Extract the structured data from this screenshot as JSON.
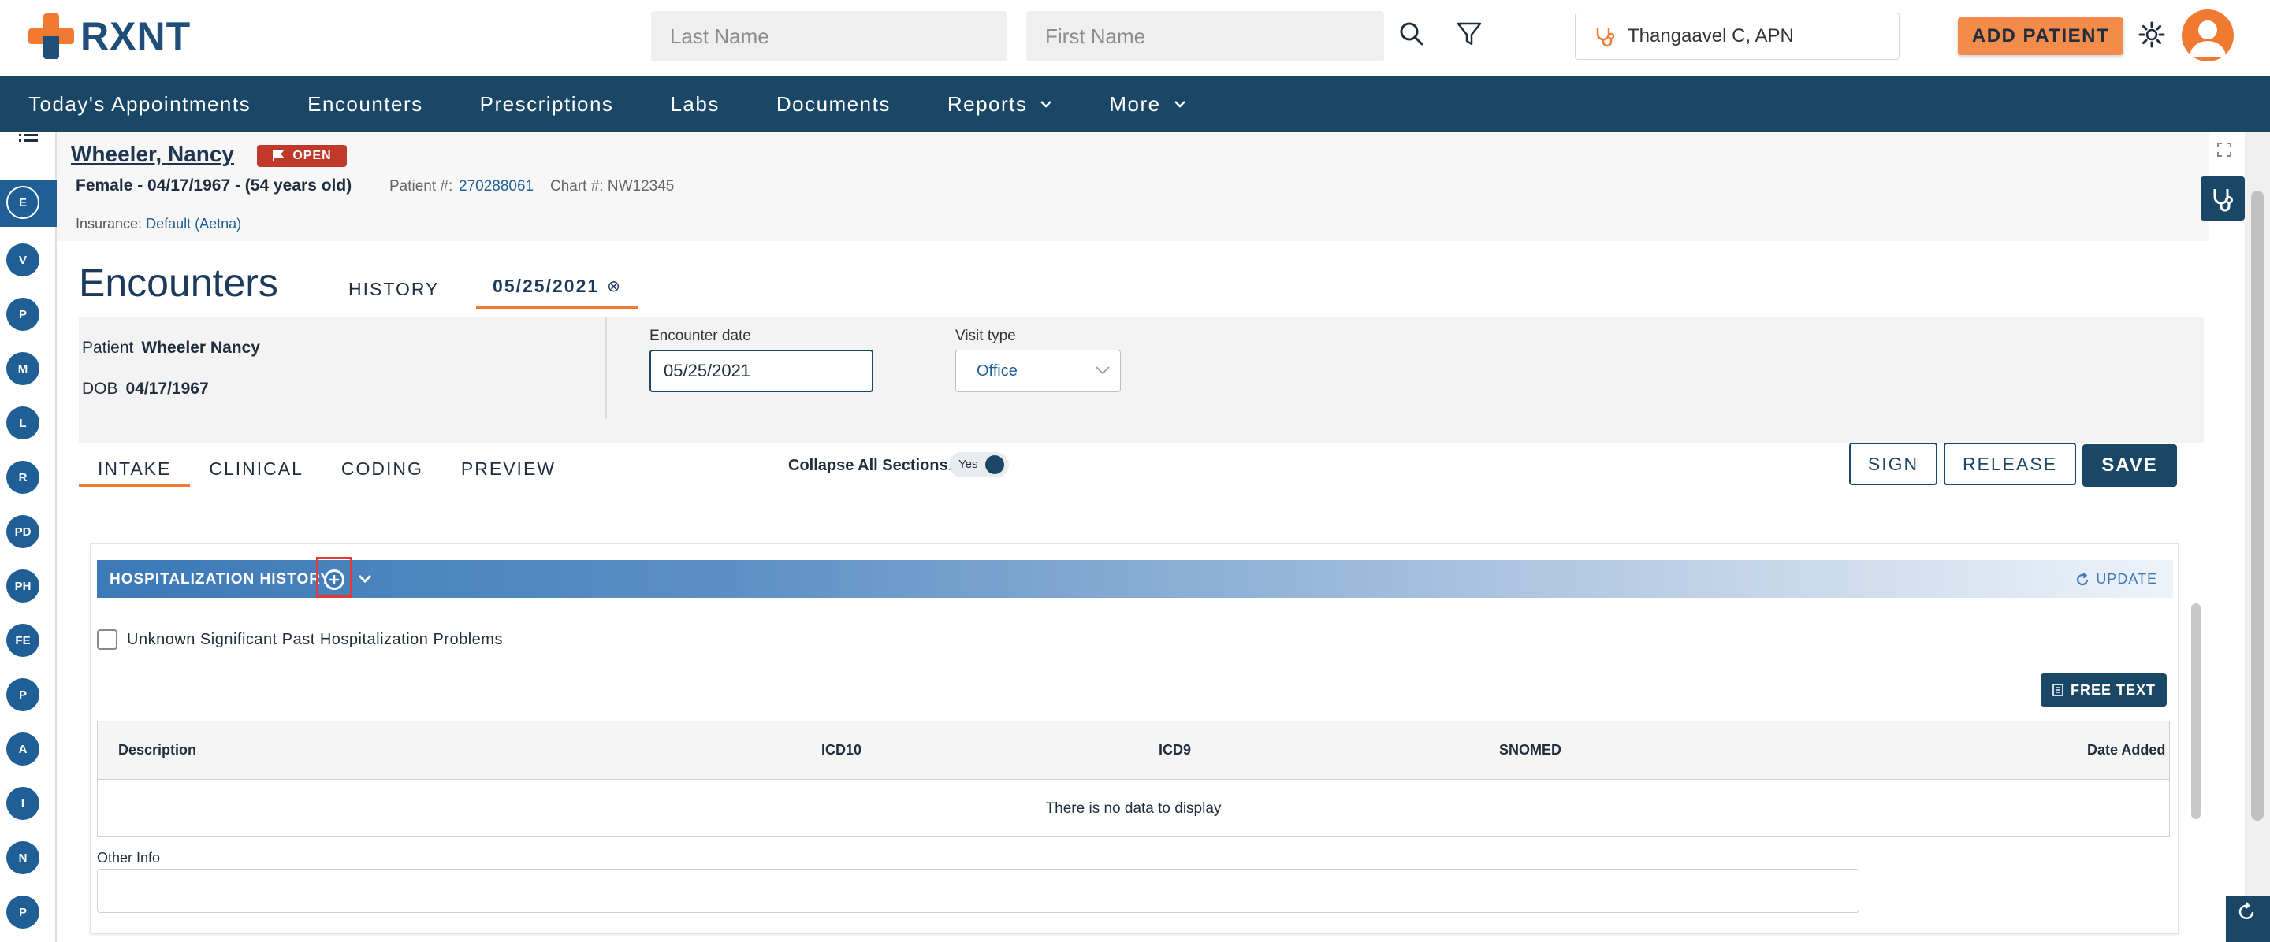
{
  "header": {
    "logo_text": "RXNT",
    "last_name_placeholder": "Last Name",
    "first_name_placeholder": "First Name",
    "provider_name": "Thangaavel C, APN",
    "add_patient_label": "ADD PATIENT"
  },
  "nav": {
    "items": [
      {
        "label": "Today's Appointments"
      },
      {
        "label": "Encounters"
      },
      {
        "label": "Prescriptions"
      },
      {
        "label": "Labs"
      },
      {
        "label": "Documents"
      },
      {
        "label": "Reports"
      },
      {
        "label": "More"
      }
    ]
  },
  "rail": {
    "items": [
      "E",
      "V",
      "P",
      "M",
      "L",
      "R",
      "PD",
      "PH",
      "FE",
      "P",
      "A",
      "I",
      "N",
      "P"
    ]
  },
  "patient": {
    "name": "Wheeler, Nancy",
    "status": "OPEN",
    "summary": "Female - 04/17/1967 - (54 years old)",
    "patient_num_label": "Patient #:",
    "patient_num": "270288061",
    "chart_label": "Chart #: NW12345",
    "insurance_label": "Insurance:",
    "insurance_value": "Default (Aetna)"
  },
  "encounter": {
    "title": "Encounters",
    "tab_history": "HISTORY",
    "tab_date": "05/25/2021",
    "patient_label": "Patient",
    "patient_value": "Wheeler Nancy",
    "dob_label": "DOB",
    "dob_value": "04/17/1967",
    "date_label": "Encounter date",
    "date_value": "05/25/2021",
    "visit_label": "Visit type",
    "visit_value": "Office"
  },
  "subtabs": [
    "INTAKE",
    "CLINICAL",
    "CODING",
    "PREVIEW"
  ],
  "controls": {
    "collapse_label": "Collapse All Sections:",
    "collapse_value": "Yes",
    "sign": "SIGN",
    "release": "RELEASE",
    "save": "SAVE"
  },
  "section": {
    "title": "HOSPITALIZATION HISTORY",
    "update": "UPDATE",
    "checkbox_label": "Unknown Significant Past Hospitalization Problems",
    "free_text": "FREE TEXT",
    "columns": [
      "Description",
      "ICD10",
      "ICD9",
      "SNOMED",
      "Date Added"
    ],
    "empty_message": "There is no data to display",
    "other_info_label": "Other Info"
  },
  "colors": {
    "brand_orange": "#f07a32",
    "brand_navy": "#1b4766",
    "highlight_red": "#e53935"
  }
}
